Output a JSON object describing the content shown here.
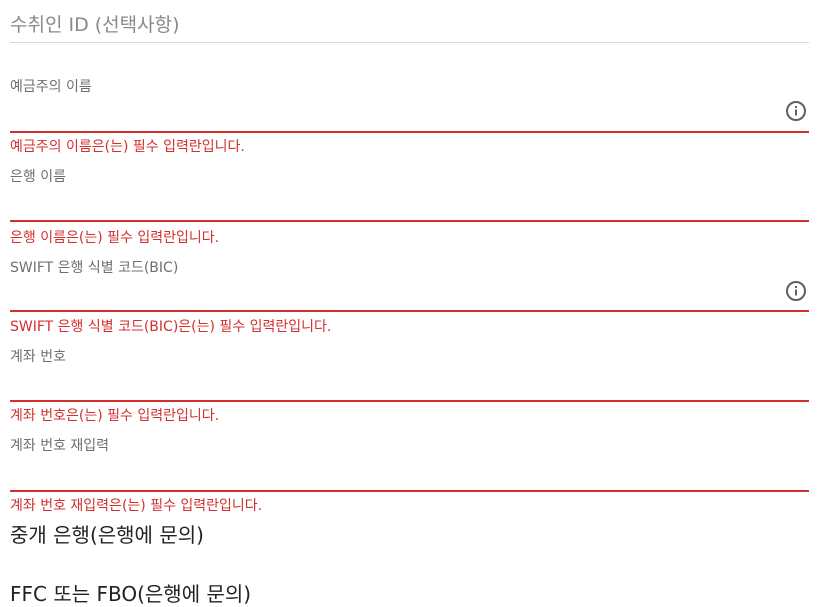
{
  "recipient_id": {
    "placeholder": "수취인 ID (선택사항)"
  },
  "fields": [
    {
      "label": "예금주의 이름",
      "error": "예금주의 이름은(는) 필수 입력란입니다.",
      "has_info_icon": true
    },
    {
      "label": "은행 이름",
      "error": "은행 이름은(는) 필수 입력란입니다.",
      "has_info_icon": false
    },
    {
      "label": "SWIFT 은행 식별 코드(BIC)",
      "error": "SWIFT 은행 식별 코드(BIC)은(는) 필수 입력란입니다.",
      "has_info_icon": true
    },
    {
      "label": "계좌 번호",
      "error": "계좌 번호은(는) 필수 입력란입니다.",
      "has_info_icon": false
    },
    {
      "label": "계좌 번호 재입력",
      "error": "계좌 번호 재입력은(는) 필수 입력란입니다.",
      "has_info_icon": false
    }
  ],
  "sections": [
    {
      "title": "중개 은행(은행에 문의)"
    },
    {
      "title": "FFC 또는 FBO(은행에 문의)"
    }
  ],
  "colors": {
    "error": "#d32f2f",
    "label": "#6f6f6f",
    "icon": "#5f5f5f",
    "divider": "#d6d6d6"
  },
  "icons": {
    "info": "info-circle-icon"
  }
}
